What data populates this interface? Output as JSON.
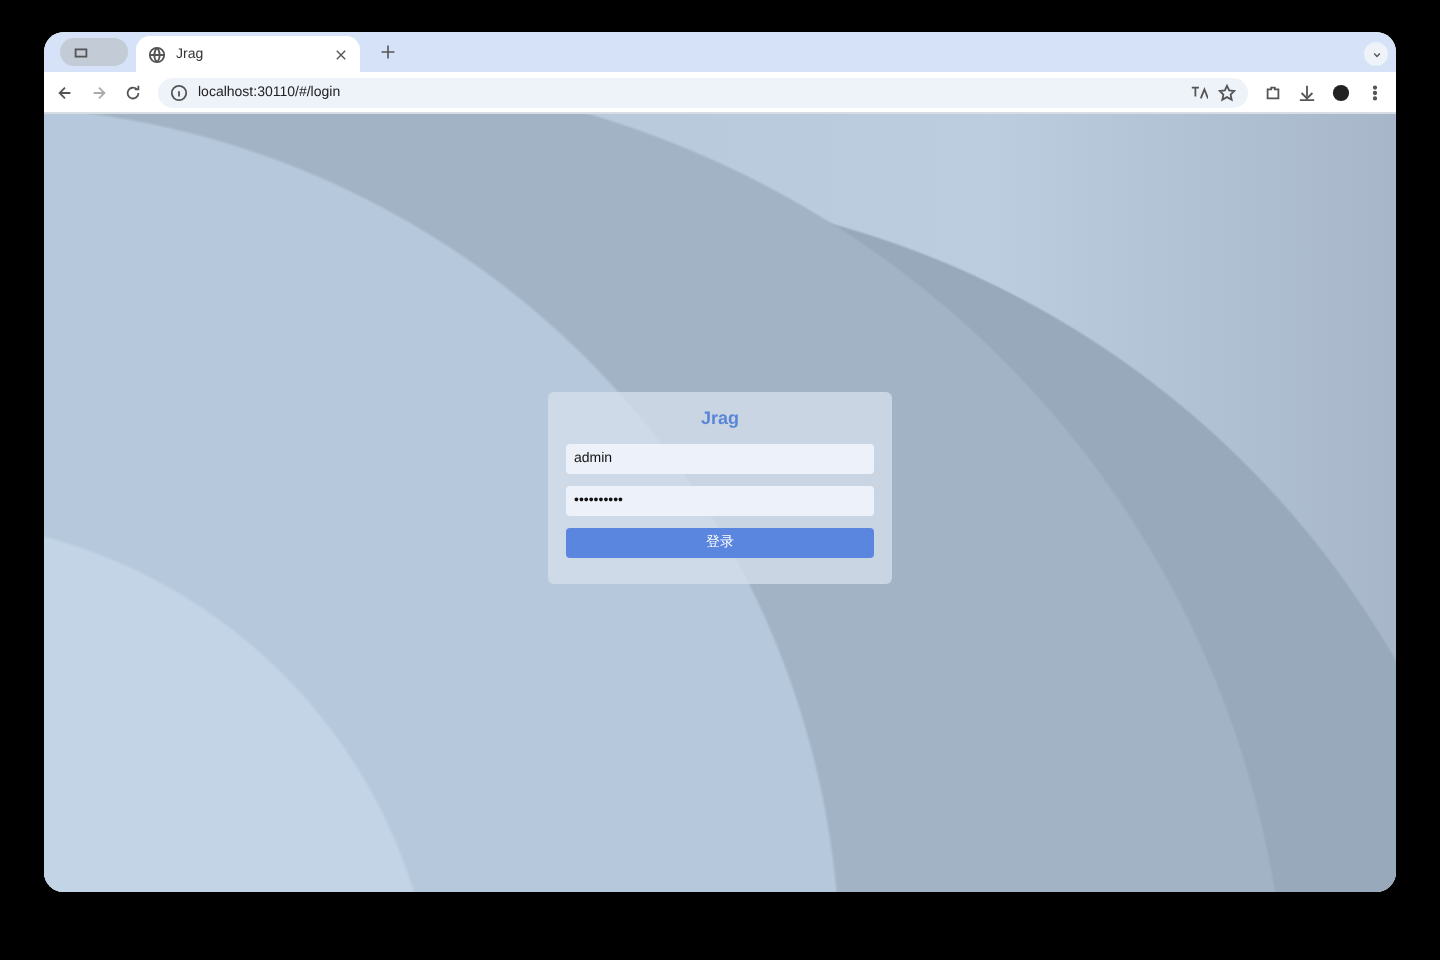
{
  "browser": {
    "tabs": [
      {
        "kind": "group",
        "selected": false
      },
      {
        "kind": "page",
        "title": "Jrag",
        "selected": true
      }
    ],
    "address": "localhost:30110/#/login"
  },
  "login": {
    "title": "Jrag",
    "username": "admin",
    "password": "••••••••••",
    "button": "登录"
  }
}
